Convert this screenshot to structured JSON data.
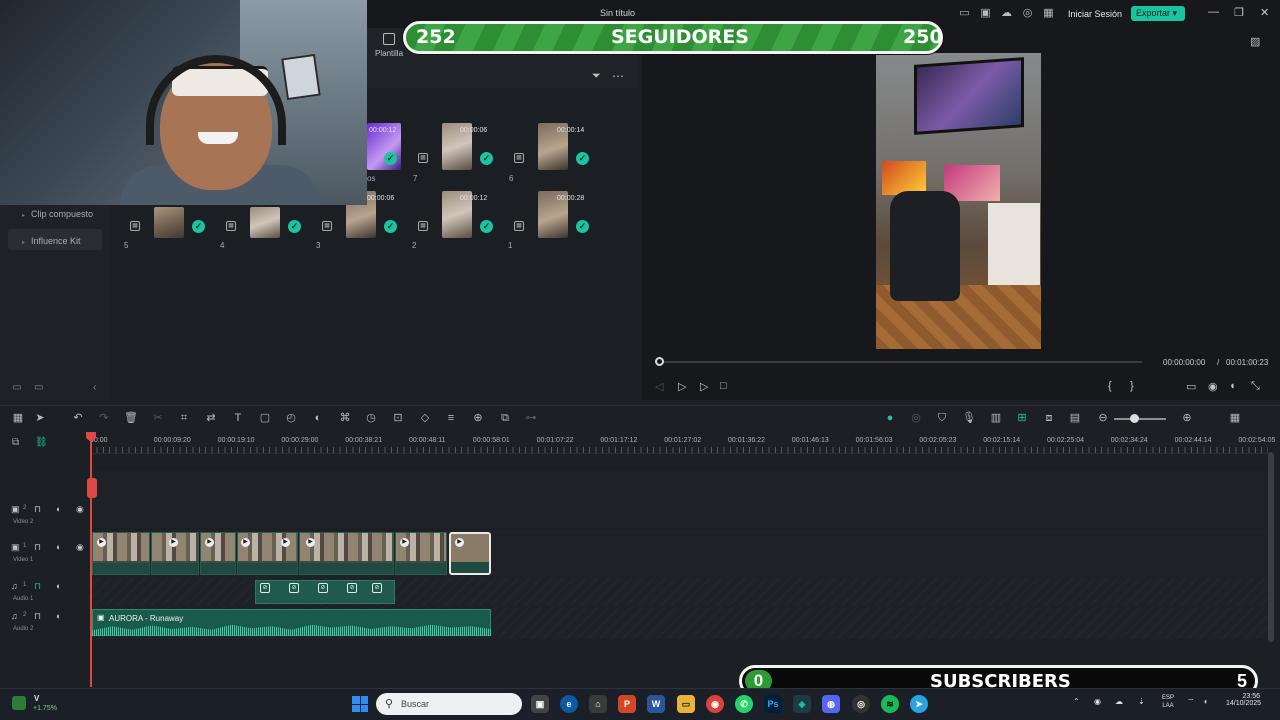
{
  "window": {
    "title": "Sin título",
    "login": "Iniciar Sesión",
    "export": "Exportar",
    "min": "—",
    "max": "❐",
    "close": "✕"
  },
  "overlay": {
    "followers_current": "252",
    "followers_label": "SEGUIDORES",
    "followers_goal": "250",
    "subscribers_current": "0",
    "subscribers_label": "SUBSCRIBERS",
    "subscribers_goal": "5"
  },
  "left_panel": {
    "items": [
      "Clip compuesto",
      "Influence Kit"
    ]
  },
  "media": {
    "header_tab": "Plantilla",
    "clips_row1": [
      {
        "duration": "00:00:12",
        "index": "os",
        "purple": true
      },
      {
        "duration": "00:00:06",
        "index": "7"
      },
      {
        "duration": "00:00:14",
        "index": "6"
      }
    ],
    "clips_row2": [
      {
        "duration": "",
        "index": "5"
      },
      {
        "duration": "",
        "index": "4"
      },
      {
        "duration": "00:00:06",
        "index": "3"
      },
      {
        "duration": "00:00:12",
        "index": "2"
      },
      {
        "duration": "00:00:28",
        "index": "1"
      }
    ]
  },
  "preview": {
    "current_time": "00:00:00:00",
    "separator": "/",
    "total_time": "00:01:00:23"
  },
  "timeline": {
    "ticks": [
      "00:00",
      "00:00:09:20",
      "00:00:19:10",
      "00:00:29:00",
      "00:00:38:21",
      "00:00:48:11",
      "00:00:58:01",
      "00:01:07:22",
      "00:01:17:12",
      "00:01:27:02",
      "00:01:36:22",
      "00:01:46:13",
      "00:01:56:03",
      "00:02:05:23",
      "00:02:15:14",
      "00:02:25:04",
      "00:02:34:24",
      "00:02:44:14",
      "00:02:54:05"
    ],
    "tracks": [
      {
        "num": "2",
        "name": "Video 2"
      },
      {
        "num": "1",
        "name": "Video 1"
      },
      {
        "num": "1",
        "name": "Audio 1"
      },
      {
        "num": "2",
        "name": "Audio 2"
      }
    ],
    "audio_clip_title": "AURORA - Runaway"
  },
  "taskbar": {
    "weather_label": "V",
    "weather_change": "+1.75%",
    "search_placeholder": "Buscar",
    "lang_top": "ESP",
    "lang_bottom": "LAA",
    "time": "23:56",
    "date": "14/10/2025",
    "apps": [
      {
        "name": "P",
        "color": "#d24726"
      },
      {
        "name": "W",
        "color": "#2b579a"
      },
      {
        "name": "Ps",
        "color": "#001e36"
      }
    ]
  },
  "colors": {
    "accent": "#19c5a0",
    "playhead": "#e04848",
    "follower_green": "#3ea545"
  }
}
